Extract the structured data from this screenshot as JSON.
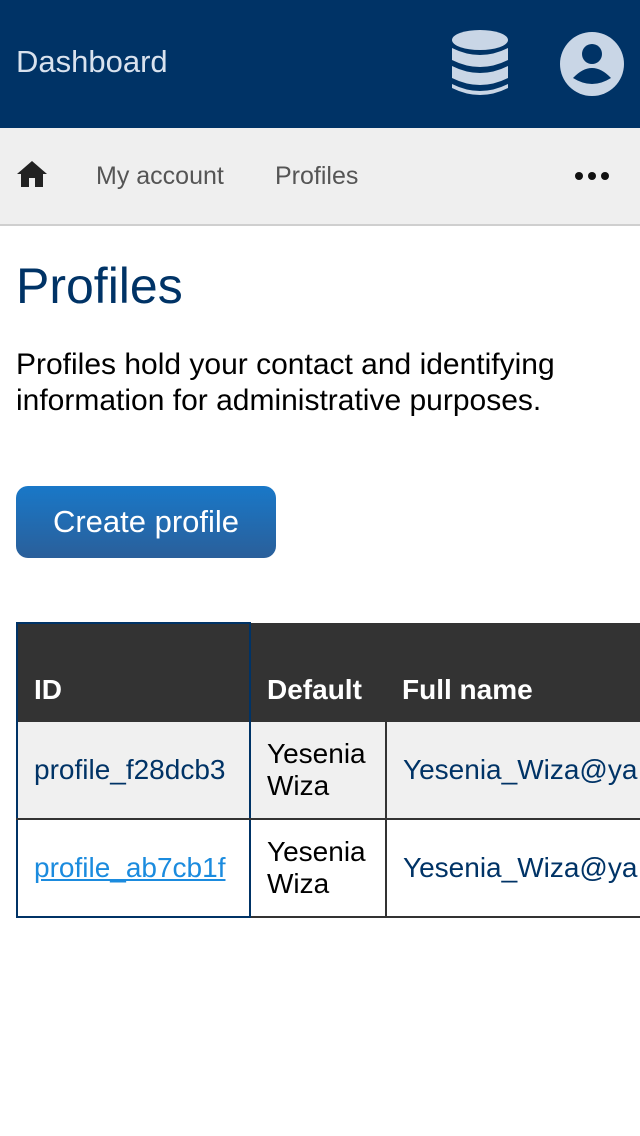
{
  "header": {
    "title": "Dashboard",
    "icons": [
      "database-icon",
      "user-account-icon"
    ],
    "background": "#003366"
  },
  "nav": {
    "home_icon": "home-icon",
    "items": [
      {
        "label": "My account"
      },
      {
        "label": "Profiles"
      }
    ],
    "more_icon": "more-dots-icon"
  },
  "main": {
    "title": "Profiles",
    "description": "Profiles hold your contact and identifying information for administrative purposes.",
    "create_button": "Create profile"
  },
  "table": {
    "columns": [
      "ID",
      "Default",
      "Full name"
    ],
    "rows": [
      {
        "id": "profile_f28dcb3",
        "default": "Yesenia Wiza",
        "full_name": "Yesenia_Wiza@ya"
      },
      {
        "id": "profile_ab7cb1f",
        "default": "Yesenia Wiza",
        "full_name": "Yesenia_Wiza@ya"
      }
    ]
  },
  "colors": {
    "brand": "#003366",
    "link": "#1b8bde",
    "button": "#1978c8",
    "table_header": "#333333"
  }
}
